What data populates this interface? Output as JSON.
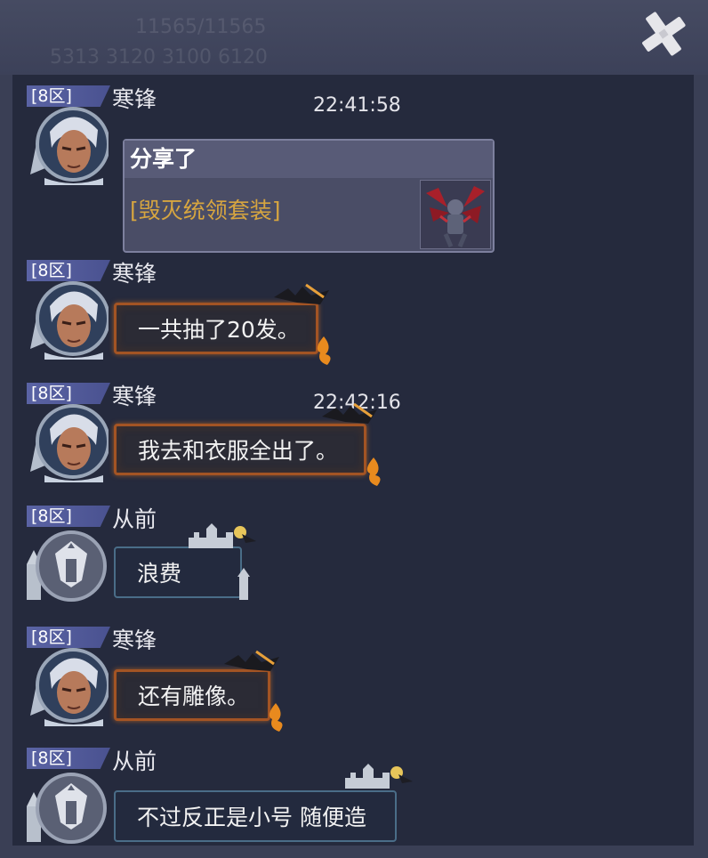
{
  "background_text": {
    "line1": "11565/11565",
    "line2": "5313   3120  3100  6120"
  },
  "messages": [
    {
      "zone": "[8区]",
      "name": "寒锋",
      "time": "22:41:58",
      "type": "share",
      "share_title": "分享了",
      "share_item": "[毁灭统领套装]"
    },
    {
      "zone": "[8区]",
      "name": "寒锋",
      "time": "",
      "type": "fire",
      "text": "一共抽了20发。"
    },
    {
      "zone": "[8区]",
      "name": "寒锋",
      "time": "22:42:16",
      "type": "fire",
      "text": "我去和衣服全出了。"
    },
    {
      "zone": "[8区]",
      "name": "从前",
      "time": "",
      "type": "castle",
      "text": "浪费"
    },
    {
      "zone": "[8区]",
      "name": "寒锋",
      "time": "",
      "type": "fire",
      "text": "还有雕像。"
    },
    {
      "zone": "[8区]",
      "name": "从前",
      "time": "",
      "type": "castle",
      "text": "不过反正是小号 随便造"
    }
  ],
  "colors": {
    "panel": "#252a3d",
    "zone_tag": "#5a63a4",
    "item_gold": "#d6a540",
    "fire_border": "#a35424",
    "castle_border": "#4a6d88"
  }
}
